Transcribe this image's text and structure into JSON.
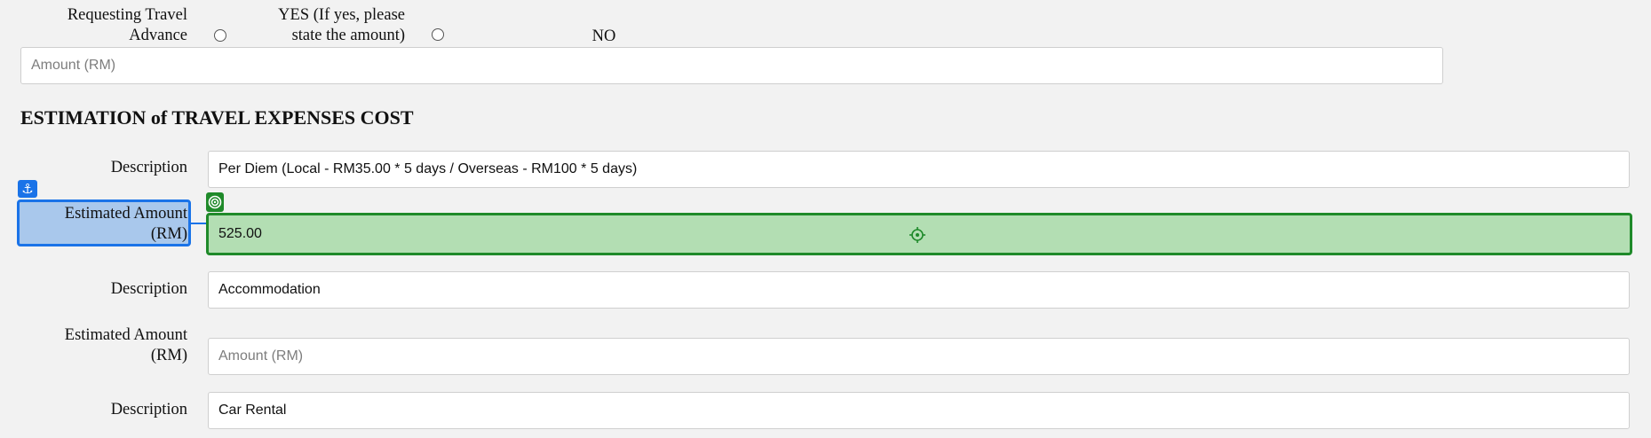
{
  "travel_advance": {
    "label": "Requesting Travel Advance",
    "label_line1": "Requesting Travel",
    "label_line2": "Advance",
    "yes_label_line1": "YES (If yes, please",
    "yes_label_line2": "state the amount)",
    "no_label": "NO",
    "amount_placeholder": "Amount (RM)"
  },
  "section": {
    "title": "ESTIMATION of TRAVEL EXPENSES COST"
  },
  "rows": [
    {
      "description_label": "Description",
      "description_value": "Per Diem (Local - RM35.00 * 5 days / Overseas - RM100 * 5 days)"
    },
    {
      "amount_label_line1": "Estimated Amount",
      "amount_label_line2": "(RM)",
      "amount_value": "525.00"
    },
    {
      "description_label": "Description",
      "description_value": "Accommodation"
    },
    {
      "amount_label_line1": "Estimated Amount",
      "amount_label_line2": "(RM)",
      "amount_placeholder": "Amount (RM)"
    },
    {
      "description_label": "Description",
      "description_value": "Car Rental"
    }
  ],
  "overlay": {
    "anchor_color": "#1a73e8",
    "target_color": "#1f8a2a",
    "anchor_icon": "anchor-icon",
    "target_icon": "target-icon",
    "crosshair_icon": "crosshair-icon"
  }
}
